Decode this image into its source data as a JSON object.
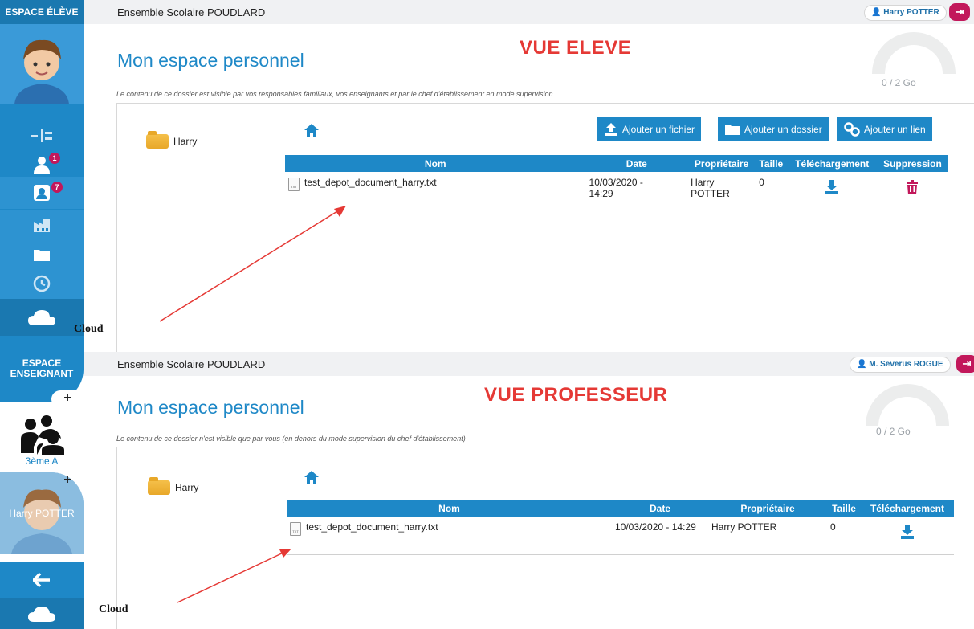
{
  "student_view": {
    "sidebar": {
      "title": "ESPACE ÉLÈVE",
      "badge_users": "1",
      "badge_contacts": "7"
    },
    "topbar": {
      "school": "Ensemble Scolaire POUDLARD",
      "user": "Harry POTTER"
    },
    "view_label": "VUE ELEVE",
    "page_title": "Mon espace personnel",
    "quota": "0 / 2 Go",
    "notice": "Le contenu de ce dossier est visible par vos responsables familiaux, vos enseignants et par le chef d'établissement en mode supervision",
    "folder": "Harry",
    "buttons": {
      "add_file": "Ajouter un fichier",
      "add_folder": "Ajouter un dossier",
      "add_link": "Ajouter un lien"
    },
    "table": {
      "headers": [
        "Nom",
        "Date",
        "Propriétaire",
        "Taille",
        "Téléchargement",
        "Suppression"
      ],
      "rows": [
        {
          "name": "test_depot_document_harry.txt",
          "date_line1": "10/03/2020 -",
          "date_line2": "14:29",
          "owner_line1": "Harry",
          "owner_line2": "POTTER",
          "size": "0"
        }
      ]
    },
    "annotation": "Cloud"
  },
  "teacher_view": {
    "sidebar": {
      "title_line1": "ESPACE",
      "title_line2": "ENSEIGNANT",
      "class_label": "3ème A",
      "student_label": "Harry POTTER"
    },
    "topbar": {
      "school": "Ensemble Scolaire POUDLARD",
      "user": "M. Severus ROGUE"
    },
    "view_label": "VUE PROFESSEUR",
    "page_title": "Mon espace personnel",
    "quota": "0 / 2 Go",
    "notice": "Le contenu de ce dossier n'est visible que par vous (en dehors du mode supervision du chef d'établissement)",
    "folder": "Harry",
    "table": {
      "headers": [
        "Nom",
        "Date",
        "Propriétaire",
        "Taille",
        "Téléchargement"
      ],
      "rows": [
        {
          "name": "test_depot_document_harry.txt",
          "date": "10/03/2020 - 14:29",
          "owner": "Harry POTTER",
          "size": "0"
        }
      ]
    },
    "annotation": "Cloud"
  },
  "colors": {
    "accent": "#1e88c7",
    "danger": "#c2185b",
    "label_red": "#e53935"
  },
  "icons": [
    "user-icon",
    "logout-icon",
    "home-icon",
    "folder-icon",
    "upload-icon",
    "link-icon",
    "file-icon",
    "download-icon",
    "trash-icon",
    "cloud-icon",
    "back-arrow-icon",
    "timeline-icon",
    "history-icon",
    "factory-icon",
    "contacts-icon",
    "users-icon",
    "group-icon"
  ]
}
